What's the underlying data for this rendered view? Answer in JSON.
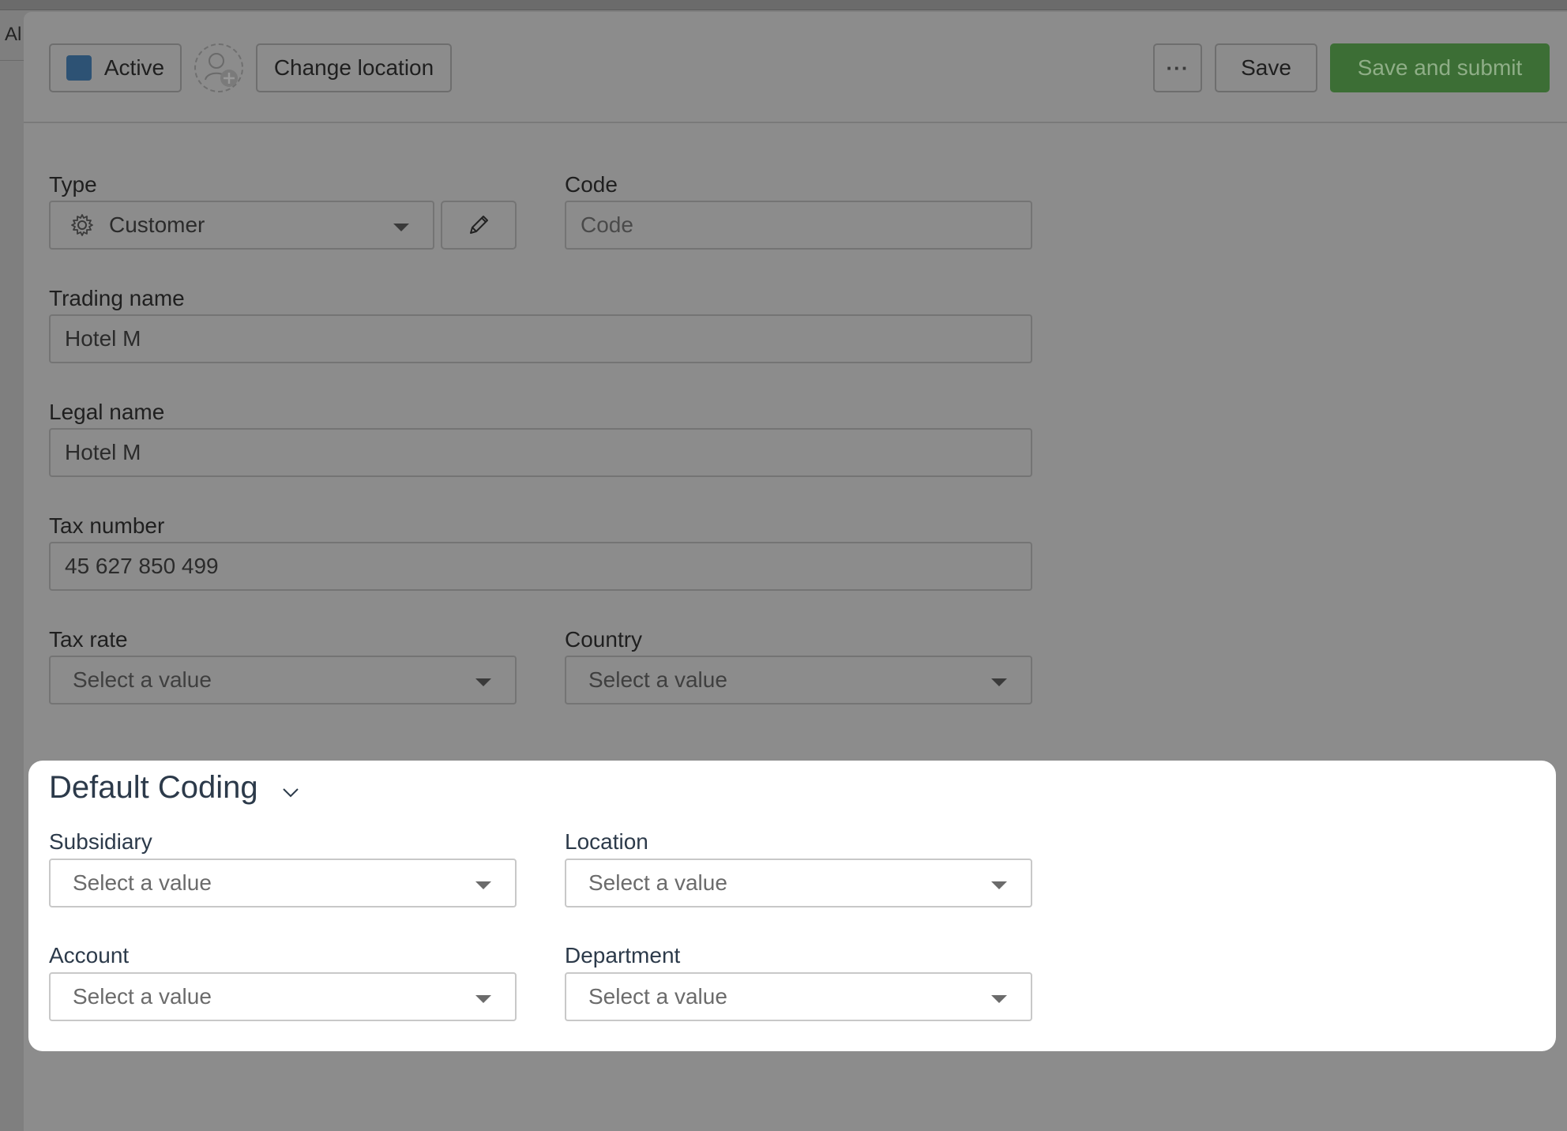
{
  "background": {
    "side_text": "Al"
  },
  "toolbar": {
    "status_label": "Active",
    "change_location_label": "Change location",
    "more_label": "···",
    "save_label": "Save",
    "save_submit_label": "Save and submit",
    "colors": {
      "status_swatch": "#2d5274",
      "primary": "#3c6e35"
    }
  },
  "form": {
    "type": {
      "label": "Type",
      "value": "Customer",
      "icon": "gear-icon"
    },
    "edit_icon": "pencil-icon",
    "code": {
      "label": "Code",
      "placeholder": "Code"
    },
    "trading_name": {
      "label": "Trading name",
      "value": "Hotel M"
    },
    "legal_name": {
      "label": "Legal name",
      "value": "Hotel M"
    },
    "tax_number": {
      "label": "Tax number",
      "value": "45 627 850 499"
    },
    "tax_rate": {
      "label": "Tax rate",
      "placeholder": "Select a value"
    },
    "country": {
      "label": "Country",
      "placeholder": "Select a value"
    }
  },
  "default_coding": {
    "title": "Default Coding",
    "subsidiary": {
      "label": "Subsidiary",
      "placeholder": "Select a value"
    },
    "location": {
      "label": "Location",
      "placeholder": "Select a value"
    },
    "account": {
      "label": "Account",
      "placeholder": "Select a value"
    },
    "department": {
      "label": "Department",
      "placeholder": "Select a value"
    }
  }
}
